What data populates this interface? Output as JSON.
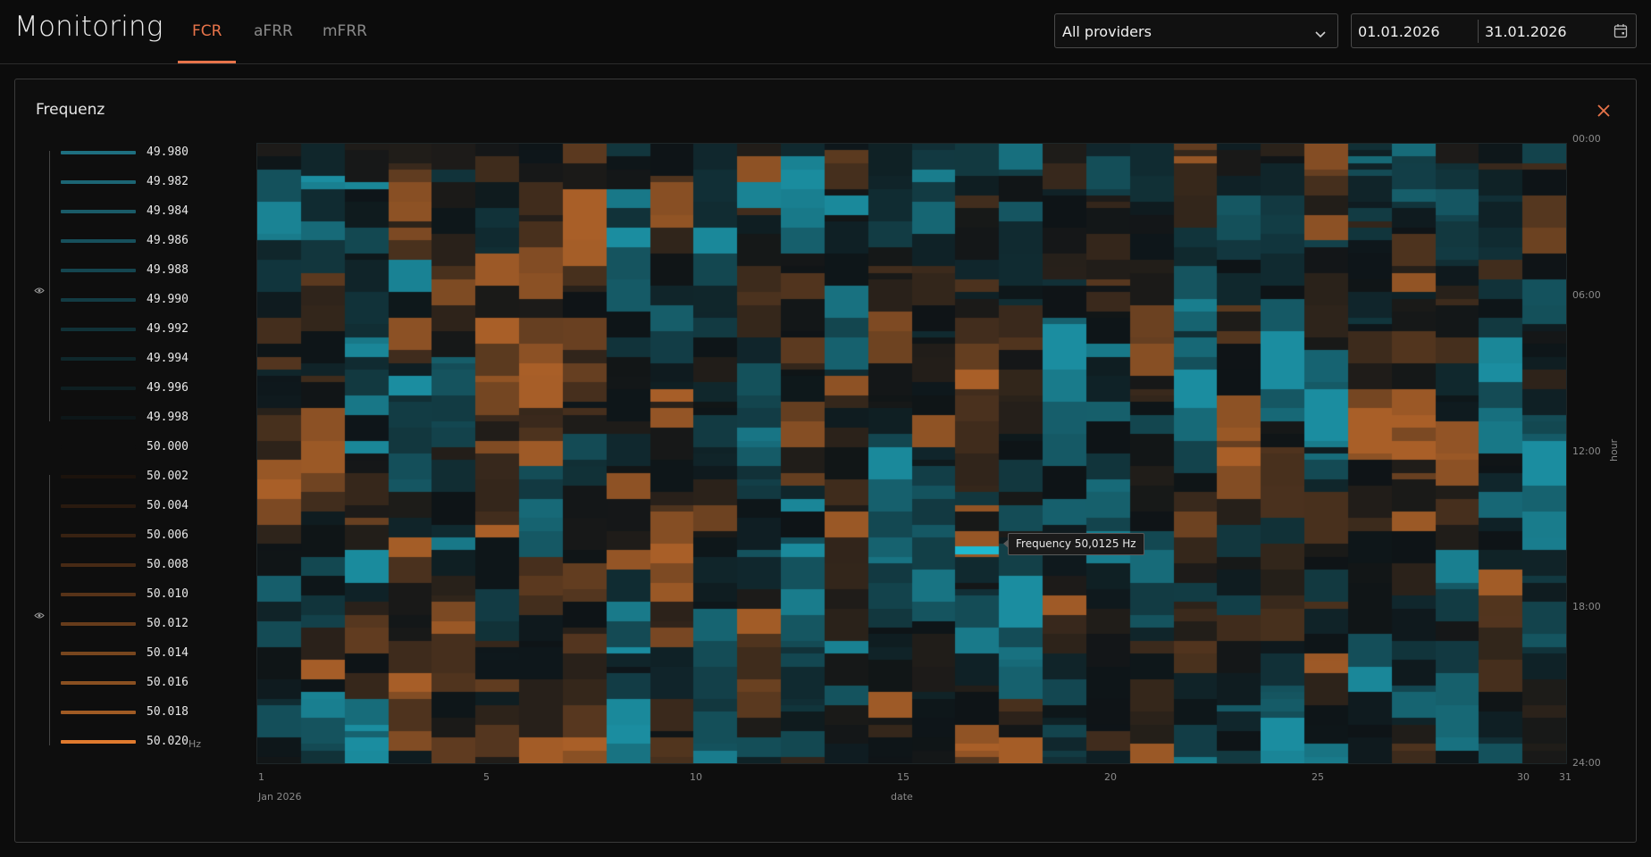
{
  "header": {
    "app_title": "Monitoring",
    "tabs": [
      {
        "label": "FCR",
        "active": true
      },
      {
        "label": "aFRR",
        "active": false
      },
      {
        "label": "mFRR",
        "active": false
      }
    ],
    "provider_select": {
      "value": "All providers",
      "icon": "chevron-down-icon"
    },
    "date_range": {
      "start": "01.01.2026",
      "end": "31.01.2026",
      "icon": "calendar-icon"
    }
  },
  "panel": {
    "title": "Frequenz",
    "close_icon": "close-icon",
    "legend": {
      "eye_icon": "eye-icon",
      "unit": "Hz",
      "items": [
        {
          "label": "49.980",
          "color": "#1e6f80"
        },
        {
          "label": "49.982",
          "color": "#1c6574"
        },
        {
          "label": "49.984",
          "color": "#1a5b68"
        },
        {
          "label": "49.986",
          "color": "#17505c"
        },
        {
          "label": "49.988",
          "color": "#154650"
        },
        {
          "label": "49.990",
          "color": "#133c44"
        },
        {
          "label": "49.992",
          "color": "#113238"
        },
        {
          "label": "49.994",
          "color": "#0f282c"
        },
        {
          "label": "49.996",
          "color": "#0e1f22"
        },
        {
          "label": "49.998",
          "color": "#0d1719"
        },
        {
          "label": "50.000",
          "color": "#0e0e0e"
        },
        {
          "label": "50.002",
          "color": "#1c130c"
        },
        {
          "label": "50.004",
          "color": "#2a1a0f"
        },
        {
          "label": "50.006",
          "color": "#382212"
        },
        {
          "label": "50.008",
          "color": "#472a15"
        },
        {
          "label": "50.010",
          "color": "#573318"
        },
        {
          "label": "50.012",
          "color": "#673c1b"
        },
        {
          "label": "50.014",
          "color": "#78461e"
        },
        {
          "label": "50.016",
          "color": "#8a5021"
        },
        {
          "label": "50.018",
          "color": "#a05b24"
        },
        {
          "label": "50.020",
          "color": "#e07a2e"
        }
      ]
    }
  },
  "chart_data": {
    "type": "heatmap",
    "title": "Frequenz",
    "xlabel": "date",
    "ylabel": "hour",
    "x_unit_label": "Jan 2026",
    "x_ticks": [
      "1",
      "5",
      "10",
      "15",
      "20",
      "25",
      "30",
      "31"
    ],
    "y_ticks": [
      "00:00",
      "06:00",
      "12:00",
      "18:00",
      "24:00"
    ],
    "x_range": [
      1,
      31
    ],
    "y_range_hours": [
      0,
      24
    ],
    "value_range_hz": [
      49.98,
      50.02
    ],
    "colors": {
      "low": "#1fb8d0",
      "mid": "#0e1417",
      "high": "#e07a2e"
    },
    "tooltip": {
      "label": "Frequency",
      "value": "50,0125 Hz",
      "day": 17,
      "hour": 15.6
    }
  }
}
